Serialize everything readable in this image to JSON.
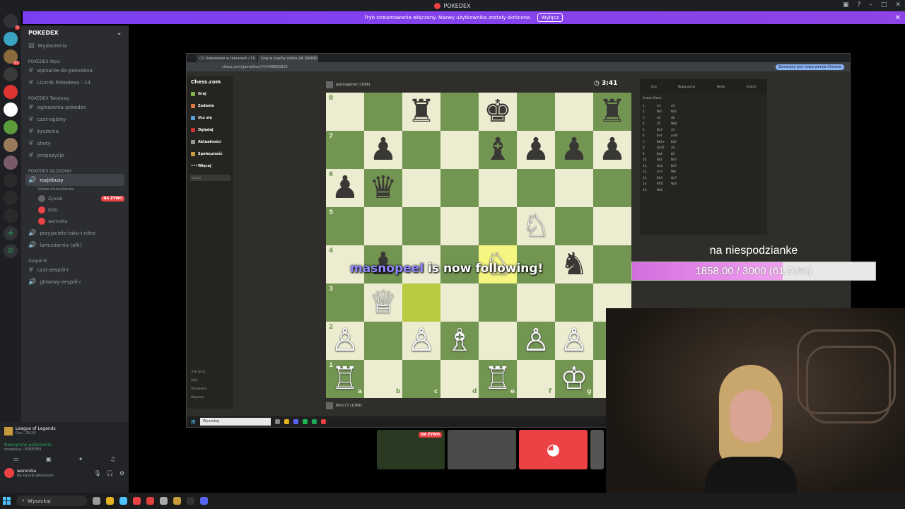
{
  "window": {
    "title": "POKEDEX"
  },
  "banner": {
    "text": "Tryb streamowania włączony. Nazwy użytkownika zostały skrócone.",
    "button": "Wyłącz"
  },
  "server": {
    "name": "POKEDEX"
  },
  "servers_badges": [
    "1",
    "21"
  ],
  "sidebar": {
    "events": "Wydarzenia",
    "categories": [
      {
        "label": "POKEDEX Wpis",
        "channels": [
          "wpisanie-do-pokedexa",
          "Licznik Pokedexa - 14"
        ]
      },
      {
        "label": "POKEDEX Tekstowy",
        "channels": [
          "ogloszenia-pokedex",
          "czat-ogólny",
          "życzenia",
          "shoty",
          "propozycje"
        ]
      },
      {
        "label": "POKEDEX GŁOSOWY",
        "channels": []
      }
    ],
    "voice_channel": {
      "name": "rozjebusy",
      "status": "Ustaw status kanału",
      "members": [
        {
          "name": "Zynlak",
          "live": "NA ŻYWO"
        },
        {
          "name": "DGU",
          "live": ""
        },
        {
          "name": "weronika",
          "live": ""
        }
      ]
    },
    "more_channels": [
      "przyjaciele-taku-i-nitro",
      "lamusiarnia (afk)"
    ],
    "team_category": "Zespół R",
    "team_channels": [
      "czat-zespół-r",
      "glosowy-zespół-r"
    ]
  },
  "userpanel": {
    "activity": "League of Legends",
    "activity_sub": "Gra - 29:26",
    "connection": "Nawiązano połączenie",
    "connection_sub": "rozjebusy / POKEDEX",
    "username": "weronika",
    "user_status": "Na kanale głosowym"
  },
  "browser": {
    "tabs": [
      "(2) Odpowiedz w tematach / Ch...",
      "Graj w szachy online ZA DARMO"
    ],
    "url": "chess.com/game/live/141496826816",
    "update_button": "Zainstaluj jest nowa wersja Chrome"
  },
  "chess": {
    "brand": "Chess.com",
    "nav": [
      "Graj",
      "Zadania",
      "Ucz się",
      "Oglądaj",
      "Aktualności",
      "Społeczność",
      "Więcej"
    ],
    "search_placeholder": "Szukaj",
    "footer": [
      "Tryb jasny",
      "Zwiń",
      "Ustawienia",
      "Wsparcie"
    ],
    "top_player": "plantagenet (1096)",
    "bottom_player": "Nitro77 (1089)",
    "clock": "3:41",
    "ranks": [
      "8",
      "7",
      "6",
      "5",
      "4",
      "3",
      "2",
      "1"
    ],
    "files": [
      "a",
      "b",
      "c",
      "d",
      "e",
      "f",
      "g"
    ],
    "opening": "Scotch Game",
    "panel_tabs": [
      "Graj",
      "Nowa partia",
      "Partie",
      "Gracze"
    ],
    "moves": [
      [
        "1.",
        "e4",
        "e5"
      ],
      [
        "2.",
        "Nf3",
        "Nc6"
      ],
      [
        "3.",
        "d4",
        "d6"
      ],
      [
        "4.",
        "d5",
        "Nb8"
      ],
      [
        "5.",
        "Nc3",
        "c6"
      ],
      [
        "6.",
        "Bc4",
        "cxd5"
      ],
      [
        "7.",
        "Bb5+",
        "Bd7"
      ],
      [
        "8.",
        "Qxd5",
        "a6"
      ],
      [
        "9.",
        "Ba4",
        "b5"
      ],
      [
        "10.",
        "Bb3",
        "Nc6"
      ],
      [
        "11.",
        "Qe2",
        "Be7"
      ],
      [
        "12.",
        "O-O",
        "Nf6"
      ],
      [
        "13.",
        "Be3",
        "Qc7"
      ],
      [
        "14.",
        "Rfd1",
        "Ng4"
      ],
      [
        "15.",
        "Nd5",
        ""
      ]
    ],
    "pieces": [
      {
        "sq": "c8",
        "p": "♜",
        "c": "b"
      },
      {
        "sq": "e8",
        "p": "♚",
        "c": "b"
      },
      {
        "sq": "h8",
        "p": "♜",
        "c": "b"
      },
      {
        "sq": "b7",
        "p": "♟",
        "c": "b"
      },
      {
        "sq": "e7",
        "p": "♝",
        "c": "b"
      },
      {
        "sq": "f7",
        "p": "♟",
        "c": "b"
      },
      {
        "sq": "g7",
        "p": "♟",
        "c": "b"
      },
      {
        "sq": "h7",
        "p": "♟",
        "c": "b"
      },
      {
        "sq": "a6",
        "p": "♟",
        "c": "b"
      },
      {
        "sq": "b6",
        "p": "♛",
        "c": "b"
      },
      {
        "sq": "f5",
        "p": "♘",
        "c": "w"
      },
      {
        "sq": "b4",
        "p": "♟",
        "c": "b"
      },
      {
        "sq": "e4",
        "p": "♘",
        "c": "w"
      },
      {
        "sq": "g4",
        "p": "♞",
        "c": "b"
      },
      {
        "sq": "b3",
        "p": "♕",
        "c": "w"
      },
      {
        "sq": "a2",
        "p": "♙",
        "c": "w"
      },
      {
        "sq": "c2",
        "p": "♙",
        "c": "w"
      },
      {
        "sq": "d2",
        "p": "♗",
        "c": "w"
      },
      {
        "sq": "f2",
        "p": "♙",
        "c": "w"
      },
      {
        "sq": "g2",
        "p": "♙",
        "c": "w"
      },
      {
        "sq": "a1",
        "p": "♖",
        "c": "w"
      },
      {
        "sq": "e1",
        "p": "♖",
        "c": "w"
      },
      {
        "sq": "g1",
        "p": "♔",
        "c": "w"
      }
    ],
    "highlights": [
      {
        "sq": "e4",
        "kind": "hl"
      },
      {
        "sq": "c3",
        "kind": "hl2"
      }
    ]
  },
  "overlay": {
    "follower_name": "masnopeel",
    "follower_text": " is now following!",
    "goal_label": "na niespodzianke",
    "goal_text": "1858.00 / 3000 (61.93%)",
    "goal_fraction": 0.6193
  },
  "tiles": {
    "live_badge": "NA ŻYWO"
  },
  "inner_taskbar": {
    "search": "Wyszukaj"
  },
  "taskbar": {
    "search": "Wyszukaj"
  },
  "colors": {
    "discord_blurple": "#5865f2",
    "chess_dark": "#739552",
    "chess_light": "#ebecd0",
    "live_red": "#ed4245"
  }
}
